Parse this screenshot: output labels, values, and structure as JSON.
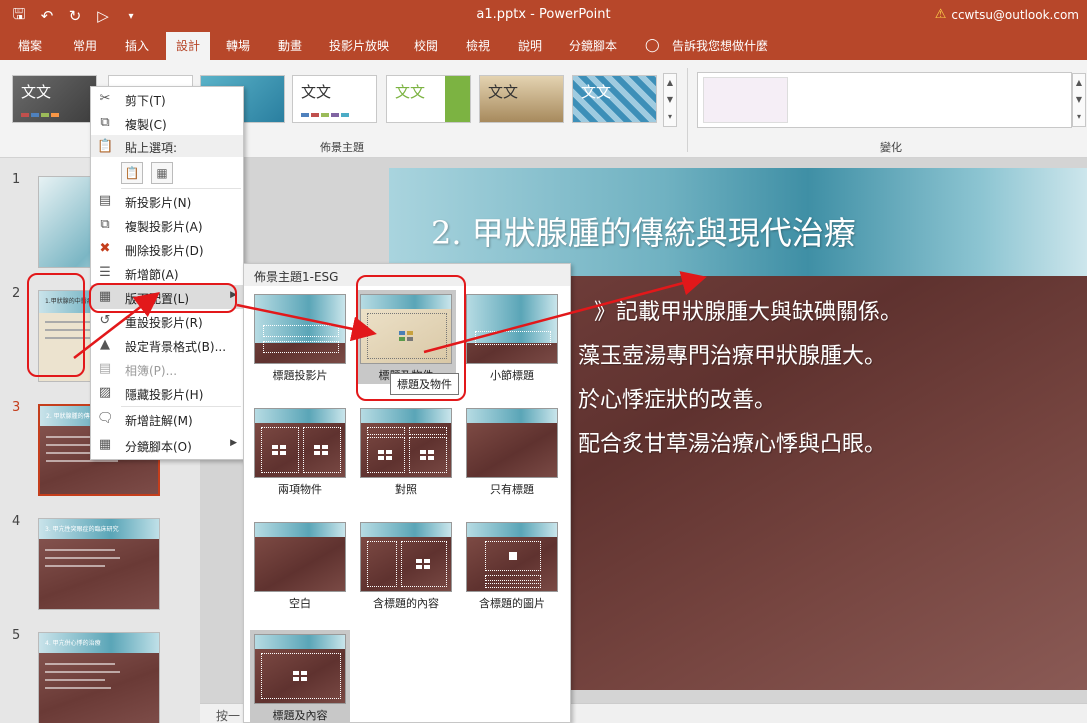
{
  "window": {
    "title": "a1.pptx  -  PowerPoint",
    "user_email": "ccwtsu@outlook.com"
  },
  "icons": {
    "save": "save-icon",
    "undo": "undo-icon",
    "redo": "redo-icon",
    "present": "present-from-beginning-icon",
    "customize": "customize-qat-icon",
    "warning": "warning-icon",
    "tellme": "lightbulb-icon"
  },
  "tabs": [
    {
      "label": "檔案"
    },
    {
      "label": "常用"
    },
    {
      "label": "插入"
    },
    {
      "label": "設計"
    },
    {
      "label": "轉場"
    },
    {
      "label": "動畫"
    },
    {
      "label": "投影片放映"
    },
    {
      "label": "校閱"
    },
    {
      "label": "檢視"
    },
    {
      "label": "說明"
    },
    {
      "label": "分鏡腳本"
    }
  ],
  "tellme": "告訴我您想做什麼",
  "ribbon": {
    "themes_group_label": "佈景主題",
    "variants_group_label": "變化",
    "theme_tile_text": "文文",
    "theme_tile_text_alt": "文文",
    "colors": {
      "accent": "#b7472a"
    }
  },
  "slides": [
    {
      "number": "1"
    },
    {
      "number": "2",
      "title": "1.甲狀腺的中醫病名"
    },
    {
      "number": "3",
      "title": "2. 甲狀腺腫的傳統與現代治療"
    },
    {
      "number": "4",
      "title": "3. 甲亢性突眼症的臨床研究"
    },
    {
      "number": "5",
      "title": "4. 甲亢併心悸的治療"
    }
  ],
  "current_slide": {
    "title": "2. 甲狀腺腫的傳統與現代治療",
    "bullets": [
      "》記載甲狀腺腫大與缺碘關係。",
      "藻玉壺湯專門治療甲狀腺腫大。",
      "於心悸症狀的改善。",
      "配合炙甘草湯治療心悸與凸眼。"
    ]
  },
  "notes_placeholder": "按一",
  "context_menu": {
    "items": [
      {
        "label": "剪下(T)",
        "icon": "cut-icon"
      },
      {
        "label": "複製(C)",
        "icon": "copy-icon"
      },
      {
        "label": "貼上選項:",
        "icon": "paste-icon"
      },
      {
        "label": "新投影片(N)",
        "icon": "new-slide-icon"
      },
      {
        "label": "複製投影片(A)",
        "icon": "duplicate-slide-icon"
      },
      {
        "label": "刪除投影片(D)",
        "icon": "delete-slide-icon"
      },
      {
        "label": "新增節(A)",
        "icon": "add-section-icon"
      },
      {
        "label": "版面配置(L)",
        "icon": "layout-icon"
      },
      {
        "label": "重設投影片(R)",
        "icon": "reset-slide-icon"
      },
      {
        "label": "設定背景格式(B)...",
        "icon": "format-background-icon"
      },
      {
        "label": "相簿(P)...",
        "icon": "photo-album-icon"
      },
      {
        "label": "隱藏投影片(H)",
        "icon": "hide-slide-icon"
      },
      {
        "label": "新增註解(M)",
        "icon": "new-comment-icon"
      },
      {
        "label": "分鏡腳本(O)",
        "icon": "storyboard-icon"
      }
    ]
  },
  "layout_gallery": {
    "header": "佈景主題1-ESG",
    "layouts": [
      {
        "label": "標題投影片"
      },
      {
        "label": "標題及物件"
      },
      {
        "label": "小節標題"
      },
      {
        "label": "兩項物件"
      },
      {
        "label": "對照"
      },
      {
        "label": "只有標題"
      },
      {
        "label": "空白"
      },
      {
        "label": "含標題的內容"
      },
      {
        "label": "含標題的圖片"
      },
      {
        "label": "標題及內容"
      }
    ],
    "tooltip": "標題及物件"
  }
}
